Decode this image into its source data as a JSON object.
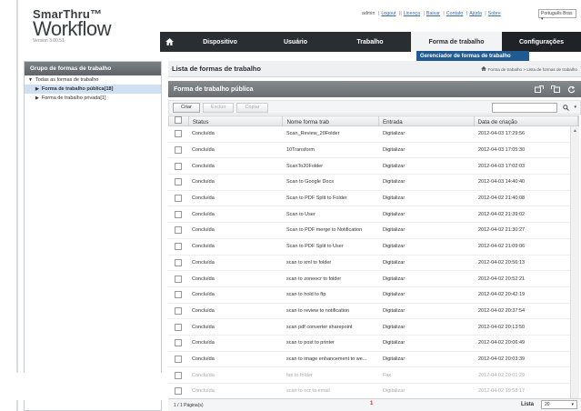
{
  "app": {
    "brand_top": "SmarThru™",
    "brand_main": "Workflow",
    "version": "Version 3.00.51"
  },
  "toplinks": {
    "user": "admin",
    "logout": "Logout",
    "links": [
      "Licença",
      "Baixar",
      "Contato",
      "Ajuda",
      "Sobre"
    ],
    "language": "Português Bras"
  },
  "nav": {
    "items": [
      "Dispositivo",
      "Usuário",
      "Trabalho",
      "Forma de trabalho",
      "Configurações"
    ],
    "dropdown_item": "Gerenciador de formas de trabalho"
  },
  "sidebar": {
    "title": "Grupo de formas de trabalho",
    "root": "Todas as formas de trabalho",
    "items": [
      "Forma de trabalho pública[18]",
      "Forma de trabalho privada[1]"
    ]
  },
  "main": {
    "title": "Lista de formas de trabalho",
    "breadcrumb": "Forma de trabalho > Lista de formas de trabalho",
    "section_title": "Forma de trabalho pública",
    "buttons": {
      "create": "Criar",
      "delete": "Excluir",
      "copy": "Copiar"
    }
  },
  "table": {
    "headers": [
      "Status",
      "Nome forma trab",
      "Entrada",
      "Data de criação"
    ],
    "rows": [
      [
        "Concluída",
        "Scan_Review_20Folder",
        "Digitalizar",
        "2012-04-03 17:29:56"
      ],
      [
        "Concluída",
        "10Transform",
        "Digitalizar",
        "2012-04-03 17:05:30"
      ],
      [
        "Concluída",
        "ScanTo20Folder",
        "Digitalizar",
        "2012-04-03 17:02:03"
      ],
      [
        "Concluída",
        "Scan to Google Docs",
        "Digitalizar",
        "2012-04-03 14:40:40"
      ],
      [
        "Concluída",
        "Scan to PDF Split to Folder",
        "Digitalizar",
        "2012-04-02 21:40:08"
      ],
      [
        "Concluída",
        "Scan to User",
        "Digitalizar",
        "2012-04-02 21:39:02"
      ],
      [
        "Concluída",
        "Scan to PDF merge to Notification",
        "Digitalizar",
        "2012-04-02 21:30:27"
      ],
      [
        "Concluída",
        "Scan to PDF Split to User",
        "Digitalizar",
        "2012-04-02 21:09:06"
      ],
      [
        "Concluída",
        "scan to xml to folder",
        "Digitalizar",
        "2012-04-02 20:56:13"
      ],
      [
        "Concluída",
        "scan to zoneocr to folder",
        "Digitalizar",
        "2012-04-02 20:52:21"
      ],
      [
        "Concluída",
        "scan to hold to ftp",
        "Digitalizar",
        "2012-04-02 20:42:19"
      ],
      [
        "Concluída",
        "scan to review to notification",
        "Digitalizar",
        "2012-04-02 20:37:54"
      ],
      [
        "Concluída",
        "scan pdf converter sharepoint",
        "Digitalizar",
        "2012-04-02 20:13:50"
      ],
      [
        "Concluída",
        "scan to post to printer",
        "Digitalizar",
        "2012-04-02 20:06:49"
      ],
      [
        "Concluída",
        "scan to image enhancement to we...",
        "Digitalizar",
        "2012-04-02 20:03:39"
      ],
      [
        "Concluída",
        "fax to folder",
        "Fax",
        "2012-04-02 20:01:29"
      ],
      [
        "Concluída",
        "scan to ocr to email",
        "Digitalizar",
        "2012-04-02 19:58:17"
      ]
    ]
  },
  "footer": {
    "page_info": "1 / 1 Página(s)",
    "current_page": "1",
    "list_label": "Lista",
    "list_size": "20"
  }
}
